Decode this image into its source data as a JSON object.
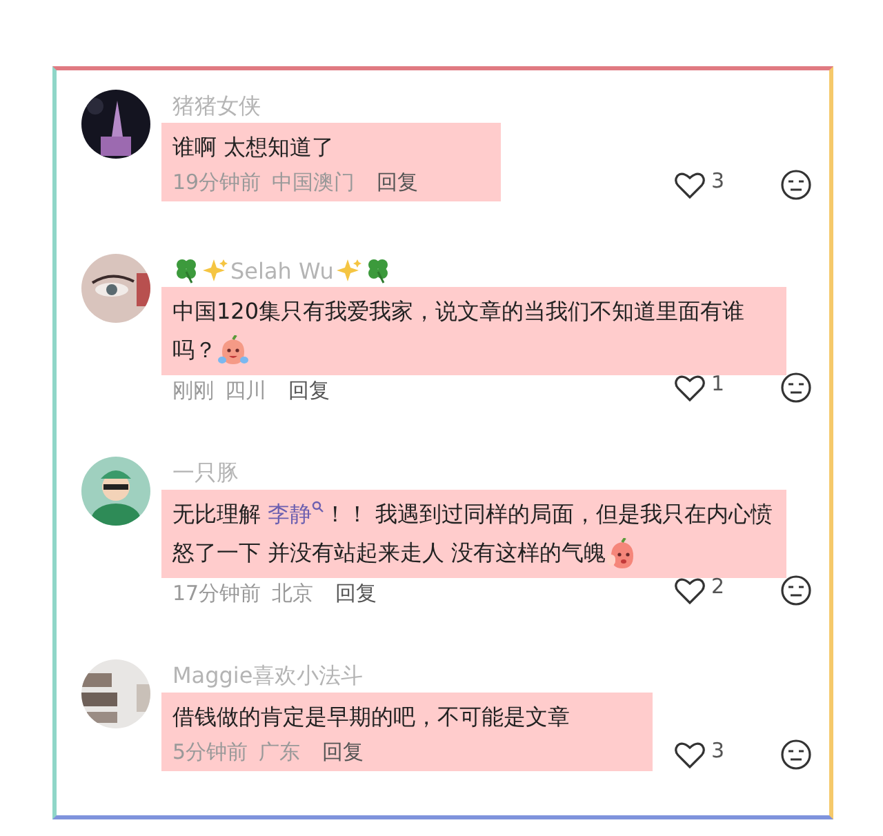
{
  "comments": [
    {
      "name": "猪猪女侠",
      "name_decor": false,
      "body": [
        {
          "kind": "text",
          "text": "谁啊 太想知道了"
        }
      ],
      "time": "19分钟前",
      "place": "中国澳门",
      "reply": "回复",
      "likes": "3",
      "body_highlighted": true,
      "meta_highlighted": true
    },
    {
      "name": "Selah Wu",
      "name_decor": true,
      "body": [
        {
          "kind": "text",
          "text": "中国120集只有我爱我家，说文章的当我们不知道里面有谁吗？"
        },
        {
          "kind": "crying_sticker"
        }
      ],
      "time": "刚刚",
      "place": "四川",
      "reply": "回复",
      "likes": "1",
      "body_highlighted": true,
      "meta_highlighted": false
    },
    {
      "name": "一只豚",
      "name_decor": false,
      "body": [
        {
          "kind": "text",
          "text": "无比理解 "
        },
        {
          "kind": "mention",
          "text": "李静"
        },
        {
          "kind": "text",
          "text": "！！ 我遇到过同样的局面，但是我只在内心愤怒了一下 并没有站起来走人 没有这样的气魄"
        },
        {
          "kind": "shy_sticker"
        }
      ],
      "time": "17分钟前",
      "place": "北京",
      "reply": "回复",
      "likes": "2",
      "body_highlighted": true,
      "meta_highlighted": false
    },
    {
      "name": "Maggie喜欢小法斗",
      "name_decor": false,
      "body": [
        {
          "kind": "text",
          "text": "借钱做的肯定是早期的吧，不可能是文章"
        }
      ],
      "time": "5分钟前",
      "place": "广东",
      "reply": "回复",
      "likes": "3",
      "body_highlighted": true,
      "meta_highlighted": true
    }
  ]
}
